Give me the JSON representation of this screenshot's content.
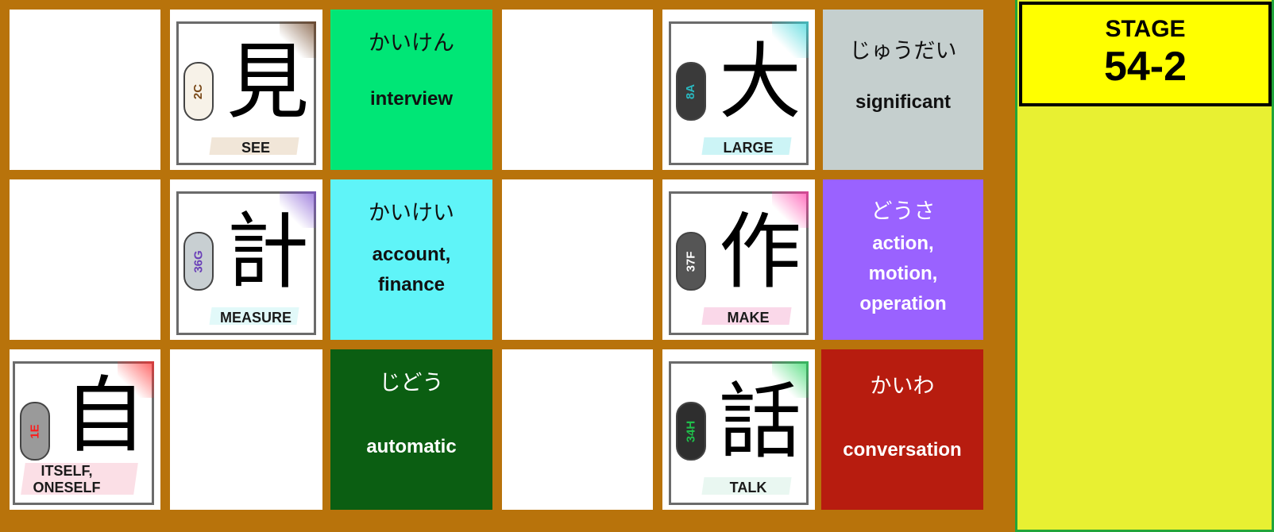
{
  "stage": {
    "label": "STAGE",
    "number": "54-2"
  },
  "kanji_cards": [
    {
      "kanji": "見",
      "code": "2C",
      "meaning": "SEE",
      "code_color": "#7a4a1a",
      "cloud_color": "#f7f2e8",
      "accent": "#6b3f1e"
    },
    {
      "kanji": "大",
      "code": "8A",
      "meaning": "LARGE",
      "code_color": "#2ab8c0",
      "cloud_color": "#3a3a3a",
      "accent": "#35d3d8"
    },
    {
      "kanji": "計",
      "code": "36G",
      "meaning": "MEASURE",
      "code_color": "#6a3fb8",
      "cloud_color": "#c8cfd2",
      "accent": "#7b4fd0"
    },
    {
      "kanji": "作",
      "code": "37F",
      "meaning": "MAKE",
      "code_color": "#ffffff",
      "cloud_color": "#555555",
      "accent": "#ff3aa5"
    },
    {
      "kanji": "自",
      "code": "1E",
      "meaning": "ITSELF, ONESELF",
      "code_color": "#ff1a1a",
      "cloud_color": "#9a9a9a",
      "accent": "#ff2a2a"
    },
    {
      "kanji": "話",
      "code": "34H",
      "meaning": "TALK",
      "code_color": "#1fbf4a",
      "cloud_color": "#2e2e2e",
      "accent": "#22d45a"
    }
  ],
  "word_cards": [
    {
      "kana": "かいけん",
      "meaning": "interview",
      "bg": "#00e676",
      "color": "#111111"
    },
    {
      "kana": "じゅうだい",
      "meaning": "significant",
      "bg": "#c5cfce",
      "color": "#111111"
    },
    {
      "kana": "かいけい",
      "meaning": "account, finance",
      "bg": "#5ff4f8",
      "color": "#111111"
    },
    {
      "kana": "どうさ",
      "meaning": "action, motion, operation",
      "bg": "#9a62ff",
      "color": "#ffffff"
    },
    {
      "kana": "じどう",
      "meaning": "automatic",
      "bg": "#0b5e12",
      "color": "#ffffff"
    },
    {
      "kana": "かいわ",
      "meaning": "conversation",
      "bg": "#b71c0f",
      "color": "#ffffff"
    }
  ]
}
